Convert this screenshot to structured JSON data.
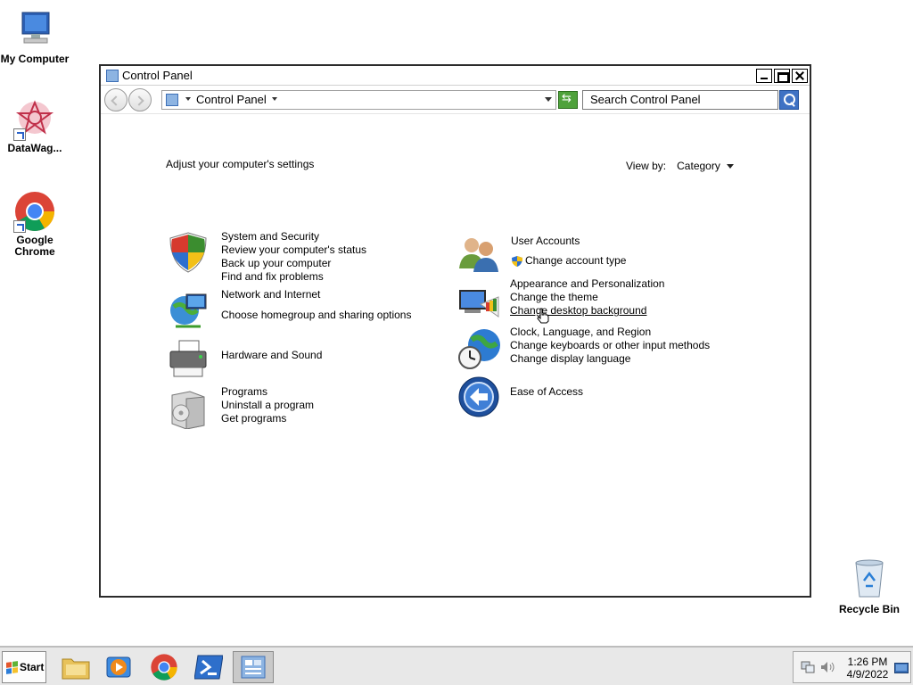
{
  "desktop": {
    "icons": [
      {
        "label": "My Computer",
        "icon": "computer-icon"
      },
      {
        "label": "DataWag...",
        "icon": "datawagon-icon"
      },
      {
        "label": "Google Chrome",
        "icon": "chrome-icon"
      },
      {
        "label": "Recycle Bin",
        "icon": "recycle-bin-icon"
      }
    ]
  },
  "window": {
    "title": "Control Panel",
    "address": {
      "crumb": "Control Panel"
    },
    "search_placeholder": "Search Control Panel",
    "heading": "Adjust your computer's settings",
    "view_by": {
      "label": "View by:",
      "value": "Category"
    },
    "categories": [
      {
        "title": "System and Security",
        "icon": "shield-icon",
        "links": [
          "Review your computer's status",
          "Back up your computer",
          "Find and fix problems"
        ]
      },
      {
        "title": "Network and Internet",
        "icon": "network-globe-icon",
        "links": [
          "Choose homegroup and sharing options"
        ]
      },
      {
        "title": "Hardware and Sound",
        "icon": "printer-icon",
        "links": []
      },
      {
        "title": "Programs",
        "icon": "programs-box-icon",
        "links": [
          "Uninstall a program",
          "Get programs"
        ]
      },
      {
        "title": "User Accounts",
        "icon": "users-icon",
        "links": [
          "Change account type"
        ]
      },
      {
        "title": "Appearance and Personalization",
        "icon": "monitor-palette-icon",
        "links": [
          "Change the theme",
          "Change desktop background"
        ]
      },
      {
        "title": "Clock, Language, and Region",
        "icon": "clock-globe-icon",
        "links": [
          "Change keyboards or other input methods",
          "Change display language"
        ]
      },
      {
        "title": "Ease of Access",
        "icon": "ease-of-access-icon",
        "links": []
      }
    ]
  },
  "taskbar": {
    "start_label": "Start",
    "apps": [
      "file-explorer-icon",
      "media-player-icon",
      "chrome-icon",
      "powershell-icon",
      "control-panel-icon"
    ],
    "clock": {
      "time": "1:26 PM",
      "date": "4/9/2022"
    }
  }
}
